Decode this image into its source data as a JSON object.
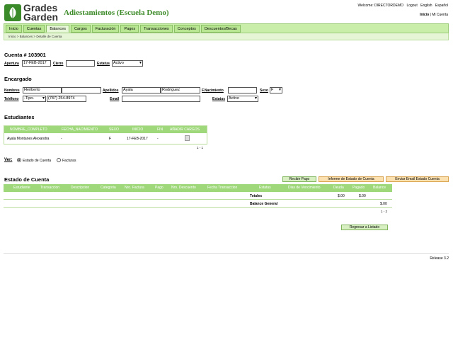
{
  "header": {
    "logo_line1": "Grades",
    "logo_line2": "Garden",
    "school": "Adiestamientos (Escuela Demo)",
    "welcome": "Welcome: DIRECTORDEMO",
    "logout": "Logout",
    "english": "English",
    "espanol": "Español",
    "inicio": "Inicio",
    "mi_cuenta": "Mi Cuenta"
  },
  "nav": [
    "Inicio",
    "Cuentas",
    "Balances",
    "Cargos",
    "Facturación",
    "Pagos",
    "Transacciones",
    "Conceptos",
    "Descuentos/Becas"
  ],
  "breadcrumb": {
    "home": "Inicio",
    "balances": "Balances",
    "current": "Detalle de Cuenta"
  },
  "cuenta": {
    "title": "Cuenta # 103901",
    "apertura_label": "Apertura",
    "apertura": "17-FEB-2017",
    "cierre_label": "Cierre",
    "cierre": "",
    "estatus_label": "Estatus",
    "estatus": "Activo"
  },
  "encargado": {
    "title": "Encargado",
    "nombres_label": "Nombres",
    "nombre1": "Heriberto",
    "nombre2": "",
    "apellidos_label": "Apellidos",
    "apellido1": "Ayala",
    "apellido2": "Rodriguez",
    "fnac_label": "F.Nacimiento",
    "fnac": "",
    "sexo_label": "Sexo",
    "sexo": "F",
    "telefono_label": "Teléfono",
    "tipo": "-Tipo-",
    "telefono": "(787) 254-8974",
    "email_label": "Email",
    "email": "",
    "estatus_label": "Estatus",
    "estatus": "Activo"
  },
  "estudiantes": {
    "title": "Estudiantes",
    "headers": [
      "NOMBRE_COMPLETO",
      "FECHA_NACIMIENTO",
      "SEXO",
      "INICIO",
      "FIN",
      "AÑADIR CARGOS"
    ],
    "rows": [
      [
        "Ayala Montanes Alexandra",
        "-",
        "F",
        "17-FEB-2017",
        "-"
      ]
    ],
    "pager": "1 - 1"
  },
  "ver": {
    "label": "Ver:",
    "opt1": "Estado de Cuenta",
    "opt2": "Facturas"
  },
  "estado": {
    "title": "Estado de Cuenta",
    "btn_recibir": "Recibir Pago",
    "btn_informe": "Informe de Estado de Cuenta",
    "btn_email": "Enviar Email Estado Cuenta",
    "headers": [
      "Estudiante",
      "Transaccion",
      "Descripcion",
      "Categoria",
      "Nro. Factura",
      "Pago",
      "Nro. Descuento",
      "Fecha Transaccion",
      "Estatus",
      "Dias de Vencimiento",
      "Deuda",
      "Pagado",
      "Balance"
    ],
    "totales_label": "Totales",
    "deuda": "$.00",
    "pagado": "$.00",
    "balance_label": "Balance General",
    "balance": "$.00",
    "pager": "1 - 2"
  },
  "regresar": "Regresar a Listado",
  "release": "Release 3.2"
}
